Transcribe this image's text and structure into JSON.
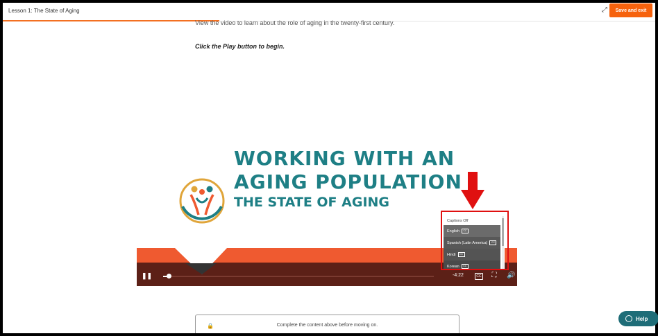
{
  "header": {
    "lesson_title": "Lesson 1: The State of Aging",
    "save_exit_label": "Save and exit",
    "expand_icon": "expand-icon"
  },
  "content": {
    "intro": "View the video to learn about the role of aging in the twenty-first century.",
    "instruction": "Click the Play button to begin."
  },
  "video": {
    "title_line1": "WORKING WITH AN",
    "title_line2": "AGING POPULATION",
    "title_line3": "THE STATE OF AGING",
    "time_remaining": "-4:22",
    "progress": 0.02,
    "cc_label": "CC",
    "colors": {
      "teal": "#1e7f85",
      "orange": "#ef5a30",
      "bar": "#5c2017"
    }
  },
  "captions_menu": {
    "off_label": "Captions Off",
    "badge": "CC",
    "languages": [
      "English",
      "Spanish (Latin America)",
      "Hindi",
      "Korean"
    ]
  },
  "locked": {
    "message": "Complete the content above before moving on."
  },
  "help": {
    "label": "Help"
  }
}
